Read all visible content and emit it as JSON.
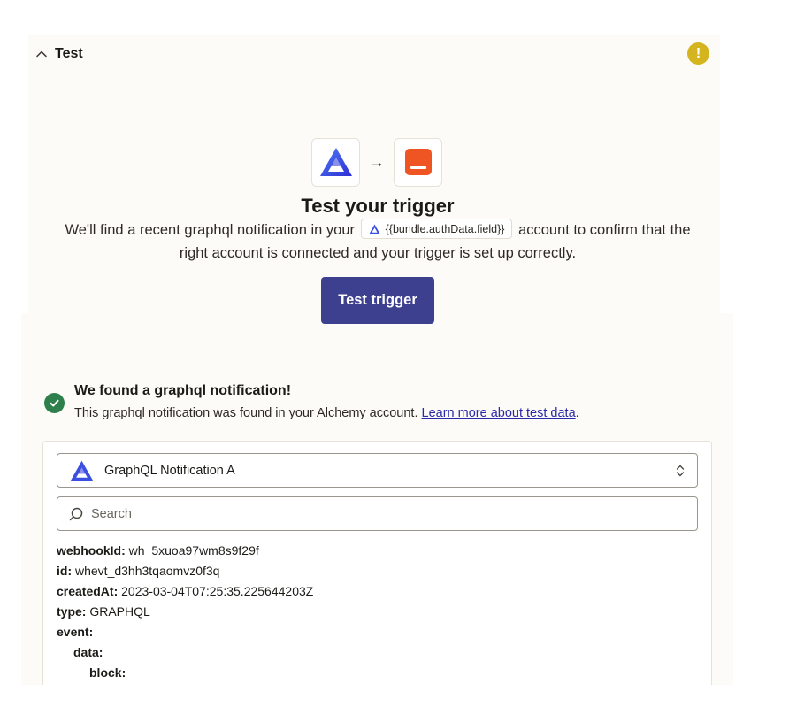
{
  "section": {
    "title": "Test"
  },
  "trigger": {
    "title": "Test your trigger",
    "desc_before": "We'll find a recent graphql notification in your",
    "chip_text": "{{bundle.authData.field}}",
    "desc_after": "account to confirm that the right account is connected and your trigger is set up correctly.",
    "button_label": "Test trigger"
  },
  "result": {
    "title": "We found a graphql notification!",
    "desc": "This graphql notification was found in your Alchemy account.",
    "link": "Learn more about test data",
    "period": "."
  },
  "sample": {
    "selected": "GraphQL Notification A",
    "search_placeholder": "Search",
    "fields": [
      {
        "key": "webhookId:",
        "value": "wh_5xuoa97wm8s9f29f"
      },
      {
        "key": "id:",
        "value": "whevt_d3hh3tqaomvz0f3q"
      },
      {
        "key": "createdAt:",
        "value": "2023-03-04T07:25:35.225644203Z"
      },
      {
        "key": "type:",
        "value": "GRAPHQL"
      },
      {
        "key": "event:",
        "value": ""
      },
      {
        "key": "data:",
        "value": ""
      },
      {
        "key": "block:",
        "value": ""
      }
    ]
  },
  "colors": {
    "primary_button": "#3d3f8f",
    "success": "#2f7f4d",
    "warning": "#d4b41f",
    "app_orange": "#ee5523",
    "alchemy_blue": "#3b4fe0",
    "panel_bg": "#fdfbf7"
  },
  "icons": {
    "header_toggle": "chevron-up-icon",
    "warning": "warning-icon",
    "source_app": "alchemy-logo-icon",
    "flow": "arrow-right-icon",
    "target_app": "app-icon",
    "success": "check-circle-icon",
    "select": "updown-caret-icon",
    "search": "search-icon"
  }
}
